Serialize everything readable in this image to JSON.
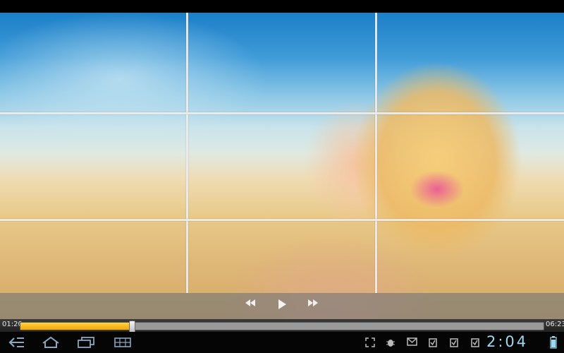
{
  "player": {
    "elapsed": "01:20",
    "duration": "06:23",
    "progress_fraction": 0.212
  },
  "controls": {
    "rewind_icon": "rewind-icon",
    "play_icon": "play-icon",
    "fast_forward_icon": "fast-forward-icon"
  },
  "system_bar": {
    "clock": "2:04",
    "nav_icons": [
      "back-icon",
      "home-icon",
      "recent-apps-icon",
      "menu-grid-icon"
    ],
    "status_icons": [
      "fullscreen-icon",
      "debug-icon",
      "gmail-icon",
      "download-complete-icon",
      "download-complete-icon",
      "download-complete-icon",
      "battery-icon"
    ],
    "accent_color": "#9ed8ef"
  },
  "colors": {
    "progress_fill": "#f2a600",
    "controls_overlay": "#787878"
  }
}
